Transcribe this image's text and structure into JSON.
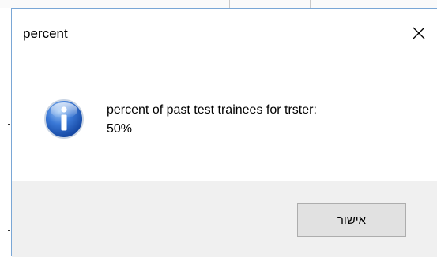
{
  "dialog": {
    "title": "percent",
    "icon": "info-icon",
    "message_line1": "percent of past test trainees for trster:",
    "message_line2": "50%",
    "ok_label": "אישור",
    "close_icon": "close-icon"
  },
  "colors": {
    "icon_blue": "#1f57b8",
    "footer_bg": "#f0f0f0",
    "button_bg": "#e1e1e1",
    "button_border": "#adadad"
  }
}
